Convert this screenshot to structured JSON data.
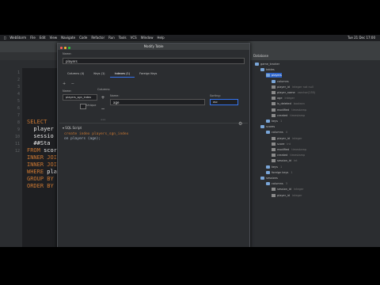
{
  "menubar": {
    "app": "WebStorm",
    "items": [
      "File",
      "Edit",
      "View",
      "Navigate",
      "Code",
      "Refactor",
      "Run",
      "Tools",
      "VCS",
      "Window",
      "Help"
    ],
    "clock": "Tue 21 Dec 17:00"
  },
  "editor": {
    "line_numbers": [
      "1",
      "2",
      "3",
      "4",
      "5",
      "6",
      "7",
      "8",
      "9",
      "10",
      "11",
      "12"
    ],
    "code_lines": [
      {
        "kw": "SELECT",
        "rest": ""
      },
      {
        "kw": "",
        "rest": "  player"
      },
      {
        "kw": "",
        "rest": "  sessio"
      },
      {
        "kw": "",
        "rest": "  ##Sta"
      },
      {
        "kw": "FROM",
        "rest": " scor"
      },
      {
        "kw": "INNER JOIN",
        "rest": ""
      },
      {
        "kw": "INNER JOIN",
        "rest": ""
      },
      {
        "kw": "WHERE",
        "rest": " pla"
      },
      {
        "kw": "GROUP BY",
        "rest": " p"
      },
      {
        "kw": "ORDER BY",
        "rest": " p"
      }
    ]
  },
  "dialog": {
    "title": "Modify Table",
    "name_label": "Name:",
    "name_value": "players",
    "tabs": [
      "Columns (4)",
      "Keys (1)",
      "Indexes (1)",
      "Foreign Keys"
    ],
    "index_name_label": "Name:",
    "index_name_value": "players_sgn_index",
    "unique_label": "Unique",
    "columns_label": "Columns:",
    "col_name_label": "Name:",
    "col_name_value": "age",
    "sorting_label": "Sorting:",
    "sorting_value": "asc",
    "ddl_label": "SQL Script",
    "ddl_lines": [
      "create index players_sgn_index",
      "    on players (age);"
    ]
  },
  "database_panel": {
    "title": "Database",
    "rows": [
      {
        "text": "player_id",
        "type": "integer not null",
        "indent": 3,
        "icon": "fld"
      },
      {
        "text": "player_name",
        "type": "varchar(255)",
        "indent": 3,
        "icon": "fld"
      },
      {
        "text": "age",
        "type": "integer",
        "indent": 3,
        "icon": "fld"
      },
      {
        "text": "is_deleted",
        "type": "boolean",
        "indent": 3,
        "icon": "fld"
      },
      {
        "text": "modified",
        "type": "timestamp",
        "indent": 3,
        "icon": "fld"
      },
      {
        "text": "created",
        "type": "timestamp",
        "indent": 3,
        "icon": "fld"
      },
      {
        "text": "keys",
        "type": "1",
        "indent": 2,
        "icon": "col"
      },
      {
        "text": "scores",
        "type": "",
        "indent": 1,
        "icon": "col"
      },
      {
        "text": "columns",
        "type": "4",
        "indent": 2,
        "icon": "col"
      },
      {
        "text": "player_id",
        "type": "integer",
        "indent": 3,
        "icon": "fld"
      },
      {
        "text": "score",
        "type": "int",
        "indent": 3,
        "icon": "fld"
      },
      {
        "text": "modified",
        "type": "timestamp",
        "indent": 3,
        "icon": "fld"
      },
      {
        "text": "created",
        "type": "timestamp",
        "indent": 3,
        "icon": "fld"
      },
      {
        "text": "session_id",
        "type": "int",
        "indent": 3,
        "icon": "fld"
      },
      {
        "text": "keys",
        "type": "1",
        "indent": 2,
        "icon": "col"
      },
      {
        "text": "foreign keys",
        "type": "1",
        "indent": 2,
        "icon": "col"
      },
      {
        "text": "sessions",
        "type": "",
        "indent": 1,
        "icon": "col"
      },
      {
        "text": "columns",
        "type": "3",
        "indent": 2,
        "icon": "col"
      },
      {
        "text": "session_id",
        "type": "integer",
        "indent": 3,
        "icon": "fld"
      },
      {
        "text": "player_id",
        "type": "integer",
        "indent": 3,
        "icon": "fld"
      }
    ],
    "top_rows": [
      {
        "text": "game_tracker",
        "indent": 0
      },
      {
        "text": "tables",
        "indent": 1
      },
      {
        "text": "players",
        "indent": 2,
        "selected": true
      },
      {
        "text": "columns",
        "indent": 3
      }
    ]
  }
}
